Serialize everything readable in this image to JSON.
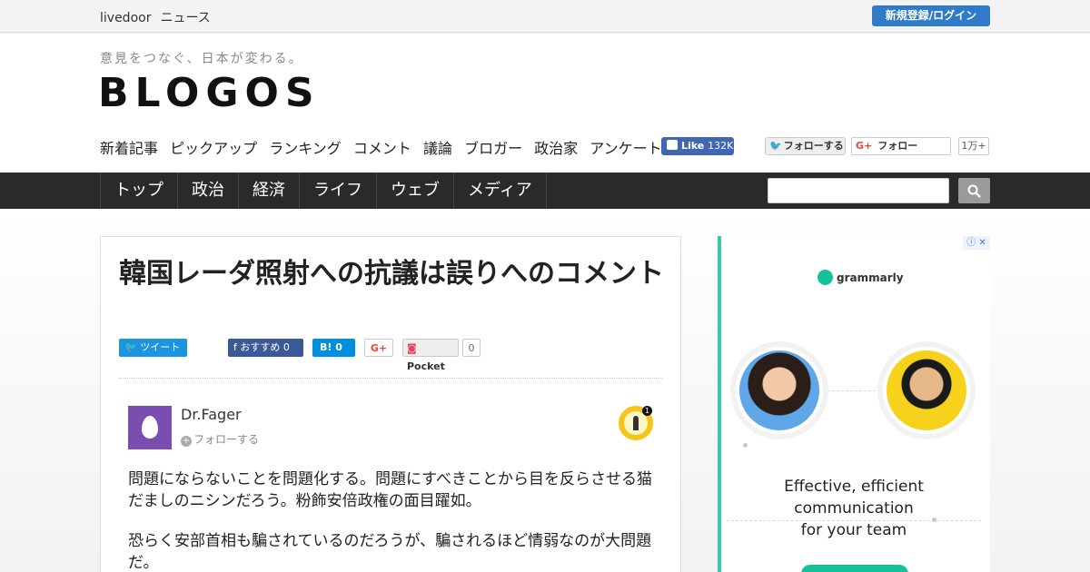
{
  "topbar": {
    "brand_parts": [
      "livedoor",
      "ニュース"
    ],
    "login_label": "新規登録/ログイン"
  },
  "header": {
    "tagline": "意見をつなぐ、日本が変わる。",
    "logo": "BLOGOS",
    "nav": [
      "新着記事",
      "ピックアップ",
      "ランキング",
      "コメント",
      "議論",
      "ブロガー",
      "政治家",
      "アンケート"
    ],
    "fb_like_label": "Like",
    "fb_like_count": "132K",
    "twitter_follow_label": "フォローする",
    "gplus_follow_label": "フォロー",
    "gplus_count": "1万+"
  },
  "main_nav": {
    "items": [
      "トップ",
      "政治",
      "経済",
      "ライフ",
      "ウェブ",
      "メディア"
    ],
    "search_placeholder": ""
  },
  "article": {
    "title": "韓国レーダ照射への抗議は誤りへのコメント",
    "share": {
      "tweet_label": "ツイート",
      "fb_label": "おすすめ",
      "fb_count": "0",
      "hatena_label": "B!",
      "hatena_count": "0",
      "gplus_label": "G+",
      "pocket_label": "Pocket",
      "pocket_count": "0"
    },
    "author": {
      "name": "Dr.Fager",
      "follow_label": "フォローする",
      "badge_count": "1"
    },
    "paragraphs": [
      "問題にならないことを問題化する。問題にすべきことから目を反らさせる猫だましのニシンだろう。粉飾安倍政権の面目躍如。",
      "恐らく安部首相も騙されているのだろうが、騙されるほど情弱なのが大問題だ。"
    ]
  },
  "ad": {
    "brand": "grammarly",
    "copy_lines": [
      "Effective, efficient",
      "communication",
      "for your team"
    ],
    "adchoices": "ⓘ ✕",
    "colors": {
      "accent": "#15c39a",
      "bar": "#3ec6a8"
    }
  },
  "colors": {
    "nav_bg": "#2a2a2a",
    "login_btn": "#2f7bc8",
    "fb_blue": "#4267b2",
    "tweet_blue": "#1b95e0"
  }
}
